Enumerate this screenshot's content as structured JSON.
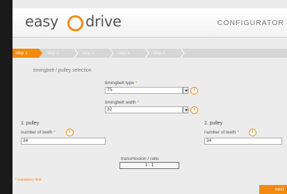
{
  "header": {
    "logo_part1": "easy",
    "logo_part2": "drive",
    "app_title": "CONFIGURATOR",
    "brand_color": "#f08b0f"
  },
  "steps": [
    "step 1",
    "step 2",
    "step 3",
    "step 4",
    "step 5"
  ],
  "active_step": "step 1",
  "form": {
    "section_title": "timingbelt / pulley selection",
    "timingbelt_type": {
      "label": "timingbelt type",
      "value": "T5"
    },
    "timingbelt_width": {
      "label": "timingbelt width",
      "value": "32"
    },
    "pulley1": {
      "heading": "1. pulley",
      "teeth_label": "number of teeth",
      "teeth_value": "34"
    },
    "pulley2": {
      "heading": "2. pulley",
      "teeth_label": "number of teeth",
      "teeth_value": "34"
    },
    "ratio": {
      "label": "transmission / ratio",
      "value": "1 : 1"
    },
    "required_mark": "*",
    "info_glyph": "i"
  },
  "footer": {
    "mandatory_note": "* mandatory field",
    "next_label": "next"
  },
  "icons": [
    "logo-ring-icon",
    "info-icon",
    "dropdown-arrow-icon",
    "chevron-right-icon"
  ]
}
